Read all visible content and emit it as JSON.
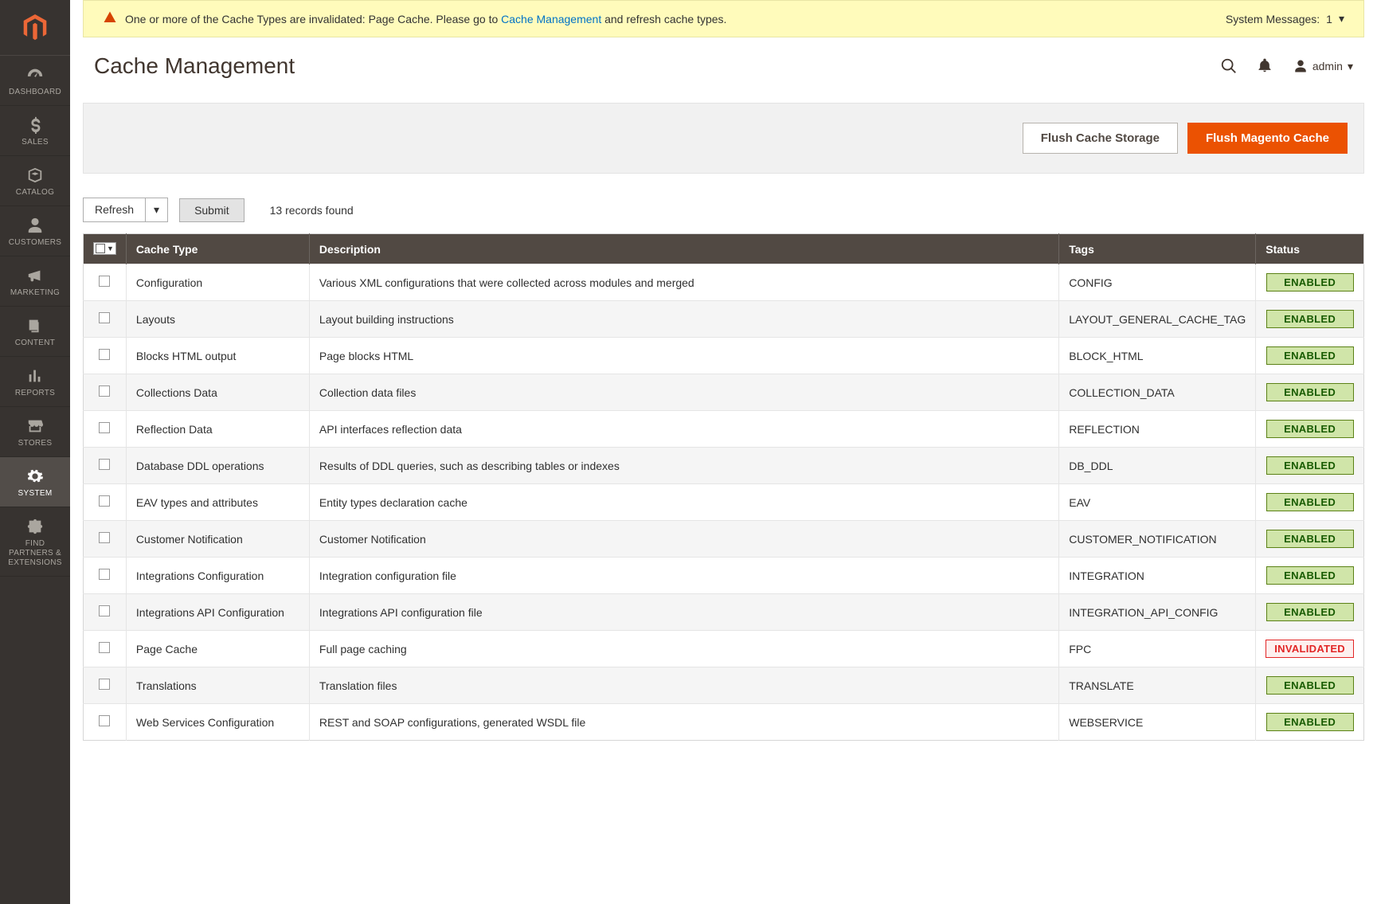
{
  "sidebar": {
    "items": [
      {
        "id": "dashboard",
        "label": "DASHBOARD",
        "icon": "gauge"
      },
      {
        "id": "sales",
        "label": "SALES",
        "icon": "dollar"
      },
      {
        "id": "catalog",
        "label": "CATALOG",
        "icon": "box"
      },
      {
        "id": "customers",
        "label": "CUSTOMERS",
        "icon": "person"
      },
      {
        "id": "marketing",
        "label": "MARKETING",
        "icon": "megaphone"
      },
      {
        "id": "content",
        "label": "CONTENT",
        "icon": "pages"
      },
      {
        "id": "reports",
        "label": "REPORTS",
        "icon": "bars"
      },
      {
        "id": "stores",
        "label": "STORES",
        "icon": "storefront"
      },
      {
        "id": "system",
        "label": "SYSTEM",
        "icon": "gear",
        "active": true
      },
      {
        "id": "partners",
        "label": "FIND PARTNERS & EXTENSIONS",
        "icon": "puzzle"
      }
    ]
  },
  "sysmsg": {
    "text_before": "One or more of the Cache Types are invalidated: Page Cache. Please go to ",
    "link_text": "Cache Management",
    "text_after": " and refresh cache types.",
    "right_label": "System Messages:",
    "right_count": "1"
  },
  "header": {
    "title": "Cache Management",
    "user": "admin"
  },
  "actions": {
    "flush_storage": "Flush Cache Storage",
    "flush_magento": "Flush Magento Cache"
  },
  "toolbar": {
    "select_label": "Refresh",
    "submit_label": "Submit",
    "records_text": "13 records found"
  },
  "table": {
    "columns": {
      "type": "Cache Type",
      "desc": "Description",
      "tags": "Tags",
      "status": "Status"
    },
    "rows": [
      {
        "type": "Configuration",
        "desc": "Various XML configurations that were collected across modules and merged",
        "tags": "CONFIG",
        "status": "ENABLED"
      },
      {
        "type": "Layouts",
        "desc": "Layout building instructions",
        "tags": "LAYOUT_GENERAL_CACHE_TAG",
        "status": "ENABLED"
      },
      {
        "type": "Blocks HTML output",
        "desc": "Page blocks HTML",
        "tags": "BLOCK_HTML",
        "status": "ENABLED"
      },
      {
        "type": "Collections Data",
        "desc": "Collection data files",
        "tags": "COLLECTION_DATA",
        "status": "ENABLED"
      },
      {
        "type": "Reflection Data",
        "desc": "API interfaces reflection data",
        "tags": "REFLECTION",
        "status": "ENABLED"
      },
      {
        "type": "Database DDL operations",
        "desc": "Results of DDL queries, such as describing tables or indexes",
        "tags": "DB_DDL",
        "status": "ENABLED"
      },
      {
        "type": "EAV types and attributes",
        "desc": "Entity types declaration cache",
        "tags": "EAV",
        "status": "ENABLED"
      },
      {
        "type": "Customer Notification",
        "desc": "Customer Notification",
        "tags": "CUSTOMER_NOTIFICATION",
        "status": "ENABLED"
      },
      {
        "type": "Integrations Configuration",
        "desc": "Integration configuration file",
        "tags": "INTEGRATION",
        "status": "ENABLED"
      },
      {
        "type": "Integrations API Configuration",
        "desc": "Integrations API configuration file",
        "tags": "INTEGRATION_API_CONFIG",
        "status": "ENABLED"
      },
      {
        "type": "Page Cache",
        "desc": "Full page caching",
        "tags": "FPC",
        "status": "INVALIDATED"
      },
      {
        "type": "Translations",
        "desc": "Translation files",
        "tags": "TRANSLATE",
        "status": "ENABLED"
      },
      {
        "type": "Web Services Configuration",
        "desc": "REST and SOAP configurations, generated WSDL file",
        "tags": "WEBSERVICE",
        "status": "ENABLED"
      }
    ]
  }
}
